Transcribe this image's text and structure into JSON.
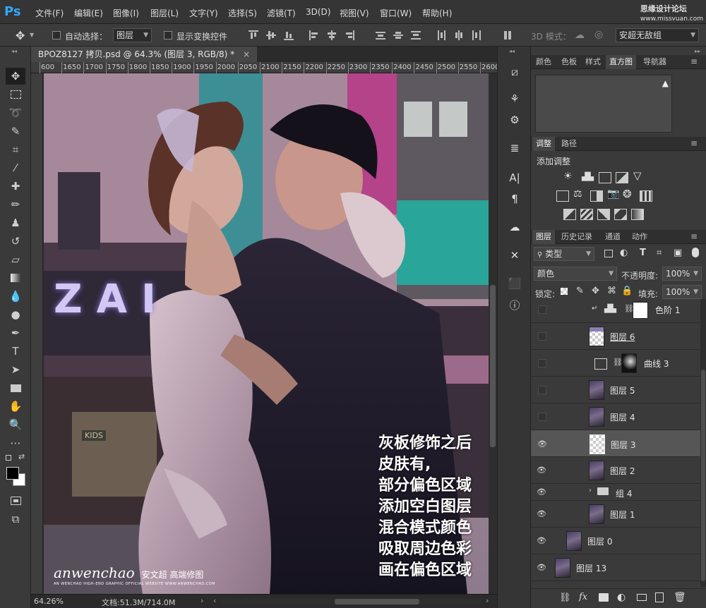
{
  "app": {
    "logo": "Ps"
  },
  "menubar": {
    "items": [
      "文件(F)",
      "编辑(E)",
      "图像(I)",
      "图层(L)",
      "文字(Y)",
      "选择(S)",
      "滤镜(T)",
      "3D(D)",
      "视图(V)",
      "窗口(W)",
      "帮助(H)"
    ],
    "watermark_line1": "思缘设计论坛",
    "watermark_line2": "www.missvuan.com"
  },
  "options": {
    "auto_select_label": "自动选择：",
    "auto_select_value": "图层",
    "show_transform_label": "显示变换控件",
    "mode_3d_label": "3D 模式：",
    "workspace_value": "安超无敌组"
  },
  "document": {
    "tab_title": "BPOZ8127 拷贝.psd @ 64.3% (图层 3, RGB/8) *",
    "ruler_marks": [
      "600",
      "1650",
      "1700",
      "1750",
      "1800",
      "1850",
      "1900",
      "1950",
      "2000",
      "2050",
      "2100",
      "2150",
      "2200",
      "2250",
      "2300",
      "2350",
      "2400",
      "2450",
      "2500",
      "2550",
      "2600"
    ],
    "sign_text": "ZAI",
    "annotation_lines": [
      "灰板修饰之后",
      "皮肤有,",
      "部分偏色区域",
      "添加空白图层",
      "混合模式颜色",
      "吸取周边色彩",
      "画在偏色区域"
    ],
    "logo_script": "anwenchao",
    "logo_cn": "安文超 高端修图",
    "logo_sub": "AN WENCHAO HIGH-END GRAPHIC OFFICIAL WEBSITE WWW.ANWENCHAO.COM",
    "shop_sign": "KIDS"
  },
  "status": {
    "zoom": "64.26%",
    "doc_info": "文档:51.3M/714.0M"
  },
  "panels": {
    "top_tabs": [
      "颜色",
      "色板",
      "样式",
      "直方图",
      "导航器"
    ],
    "adjust_tabs": [
      "调整",
      "路径"
    ],
    "add_adjustment": "添加调整",
    "layer_tabs": [
      "图层",
      "历史记录",
      "通道",
      "动作"
    ],
    "filter_kind": "类型",
    "blend_mode": "颜色",
    "opacity_label": "不透明度:",
    "opacity_value": "100%",
    "lock_label": "锁定:",
    "fill_label": "填充:",
    "fill_value": "100%"
  },
  "layers": [
    {
      "name": "色阶 1",
      "visible": false
    },
    {
      "name": "图层 6",
      "visible": false
    },
    {
      "name": "曲线 3",
      "visible": false
    },
    {
      "name": "图层 5",
      "visible": false
    },
    {
      "name": "图层 4",
      "visible": false
    },
    {
      "name": "图层 3",
      "visible": true,
      "selected": true
    },
    {
      "name": "图层 2",
      "visible": true
    },
    {
      "name": "组 4",
      "visible": true
    },
    {
      "name": "图层 1",
      "visible": true
    },
    {
      "name": "图层 0",
      "visible": true
    },
    {
      "name": "图层 13",
      "visible": true
    }
  ]
}
